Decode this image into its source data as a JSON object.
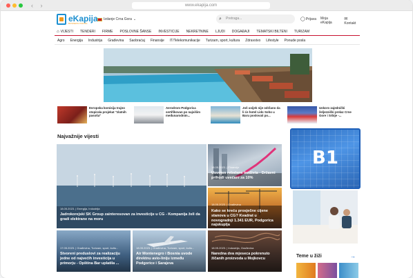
{
  "browser": {
    "url": "www.ekapija.com"
  },
  "brand": {
    "name": "eKapija",
    "tagline": "BUSINESS PORTAL"
  },
  "edition": {
    "label": "Izdanje Crna Gora"
  },
  "search": {
    "placeholder": "Pretraga..."
  },
  "toplinks": {
    "login": "Prijava",
    "my": "Moja eKapija",
    "contact": "Kontakt"
  },
  "nav": [
    "VIJESTI",
    "TENDERI",
    "FIRME",
    "POSLOVNE ŠANSE",
    "INVESTICIJE",
    "NEKRETNINE",
    "LJUDI",
    "DOGAĐAJI",
    "TEMATSKI BILTENI",
    "TURIZAM"
  ],
  "subnav": [
    "Agro",
    "Energija",
    "Industrija",
    "Građevina",
    "Saobraćaj",
    "Finansije",
    "IT/Telekomunikacije",
    "Turizam, sport, kultura",
    "Zdravstvo",
    "Lifestyle",
    "Ponude posla"
  ],
  "strip": [
    "Evropska komisija trajno stopirala projekat \"zlatnih pasoša\"",
    "Aerodrom Podgorica sertifikovan po najvišim međunarodnim...",
    "Još uvijek nije održano da li će hotel Lido Soho u Baru poslovati po...",
    "Uskoro zajednički željeznički prelaz Crne Gore i Srbije -..."
  ],
  "section": {
    "title": "Najvažnije vijesti"
  },
  "tiles": {
    "big": {
      "meta": "18.05.2023. | Energija, Industrija",
      "head": "Jadrokorejski SK Group zainteresovan za investicije u CG - Kompanija želi da gradi elektrane na moru"
    },
    "t1": {
      "meta": "18.05.2023. | Finansije",
      "head": "Usvojen rebalans budžeta - Državni prihodi uvećani za 10%"
    },
    "t2": {
      "meta": "18.05.2023. | Građevina",
      "head": "Kako se kreću prosječne cijene stanova u CG? Kvadrat u novogradnji 1.341 EUR, Podgorica najskuplja"
    },
    "b1": {
      "meta": "17.05.2023. | Građevina, Turizam, sport, kultu...",
      "head": "Stvoreni preduslovi za realizaciju jedne od najvećih investicija u primorju - Opština Bar uplatila ..."
    },
    "b2": {
      "meta": "18.05.2023. | Građevina, Turizam, sport, kultu...",
      "head": "Air Montenegro i Bosnia uvode direktnu avio-liniju između Podgorice i Sarajeva"
    },
    "b3": {
      "meta": "18.05.2023. | Industrija, Građevina",
      "head": "Naredna dva mjeseca pokrenuto žičanih proizvoda u Mojkovcu"
    }
  },
  "ad": {
    "label": "B1"
  },
  "teme": {
    "title": "Teme u žiži"
  },
  "colors": {
    "brand_blue": "#1b8fd0",
    "brand_orange": "#f29a1b",
    "nav_red": "#c8102e",
    "ad_blue": "#2f6fc0"
  }
}
